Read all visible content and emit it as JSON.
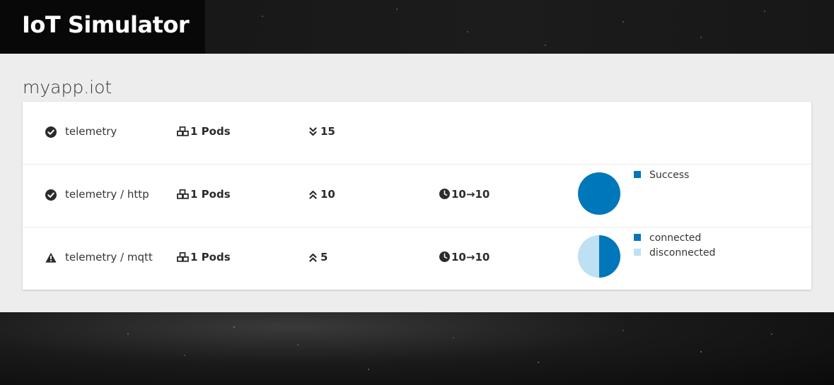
{
  "header": {
    "title": "IoT Simulator"
  },
  "app": {
    "name": "myapp.iot"
  },
  "rows": [
    {
      "name": "telemetry",
      "status_icon": "check-circle-icon",
      "pods": "1 Pods",
      "direction_icon": "chevron-double-down-icon",
      "count": "15",
      "rate": null,
      "chart": null
    },
    {
      "name": "telemetry / http",
      "status_icon": "check-circle-icon",
      "pods": "1 Pods",
      "direction_icon": "chevron-double-up-icon",
      "count": "10",
      "rate": "10→10",
      "chart": {
        "type": "pie",
        "legend": [
          {
            "label": "Success",
            "color": "#0077bb",
            "value": 1.0
          }
        ]
      }
    },
    {
      "name": "telemetry / mqtt",
      "status_icon": "warning-triangle-icon",
      "pods": "1 Pods",
      "direction_icon": "chevron-double-up-icon",
      "count": "5",
      "rate": "10→10",
      "chart": {
        "type": "pie",
        "legend": [
          {
            "label": "connected",
            "color": "#0077bb",
            "value": 0.5
          },
          {
            "label": "disconnected",
            "color": "#bde0f2",
            "value": 0.5
          }
        ]
      }
    }
  ],
  "colors": {
    "accent": "#0077bb",
    "accent_light": "#bde0f2",
    "background": "#ededed"
  }
}
